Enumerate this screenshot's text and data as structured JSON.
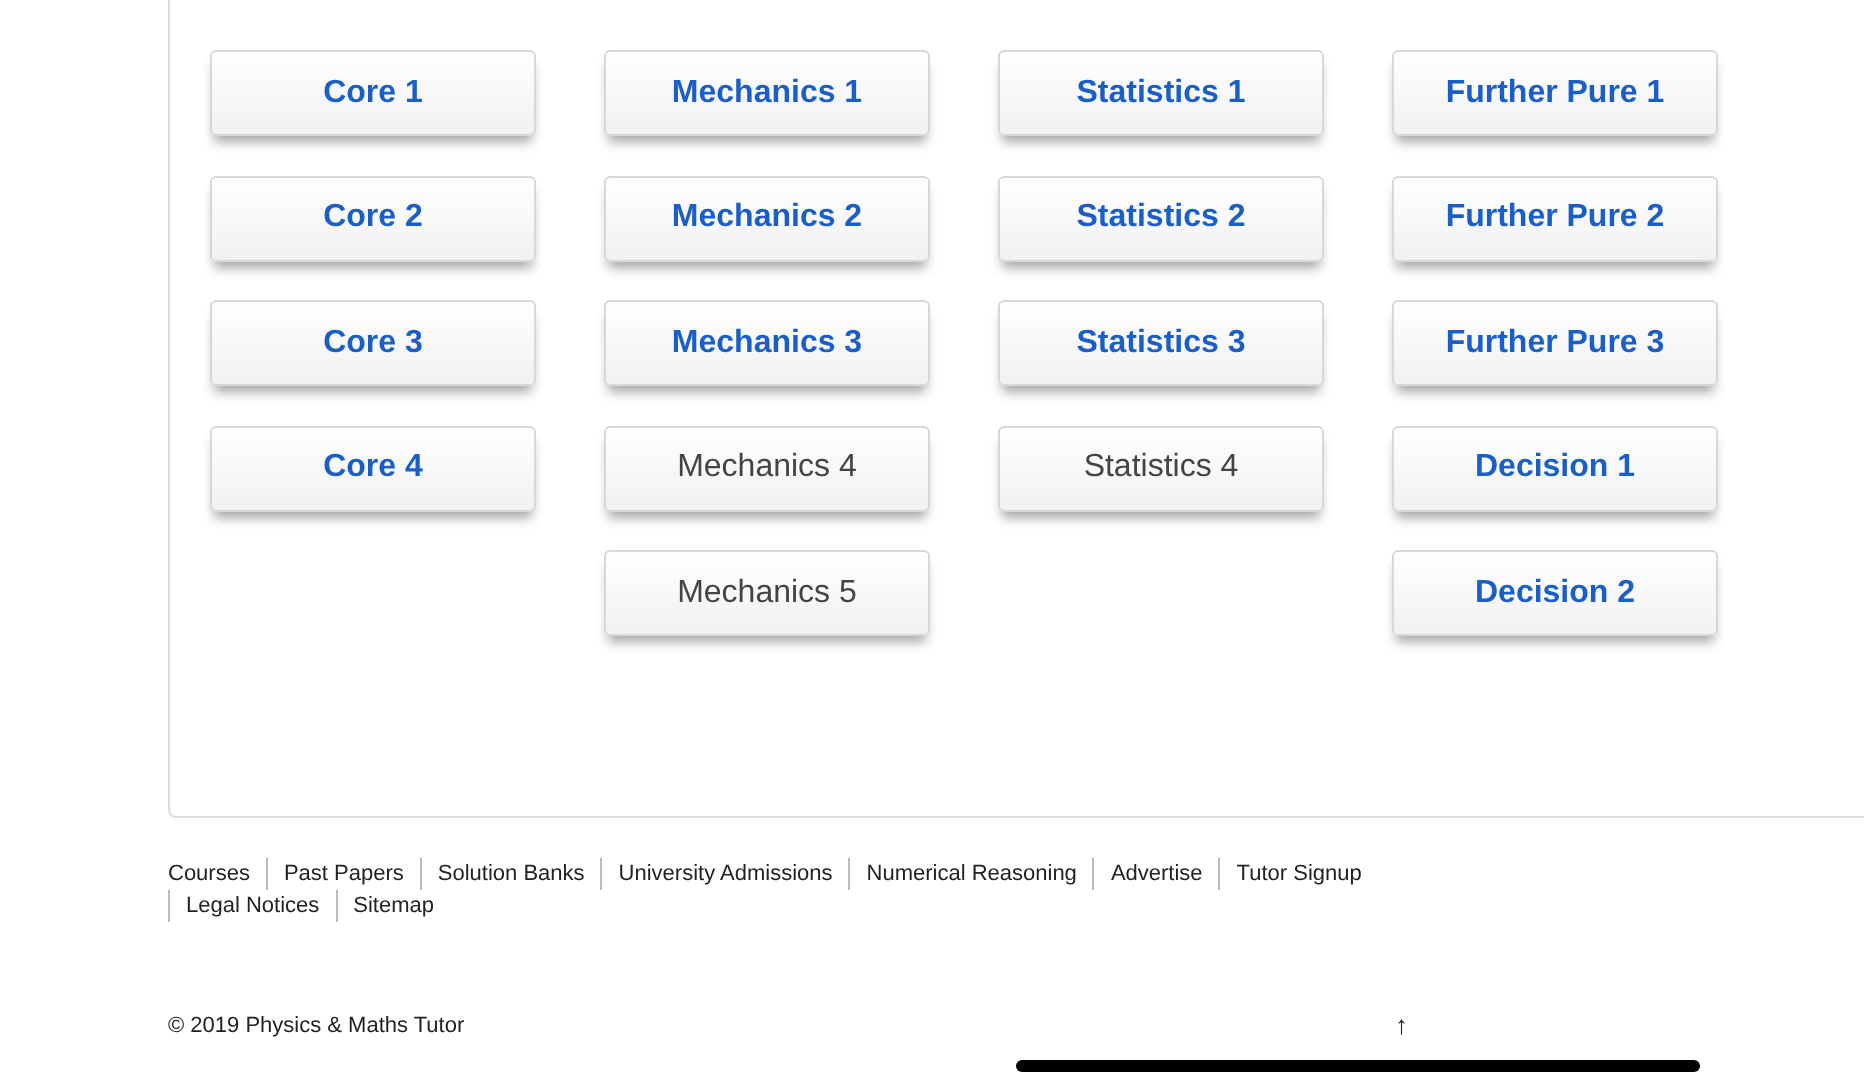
{
  "columns": [
    {
      "buttons": [
        {
          "label": "Core 1",
          "disabled": false
        },
        {
          "label": "Core 2",
          "disabled": false
        },
        {
          "label": "Core 3",
          "disabled": false
        },
        {
          "label": "Core 4",
          "disabled": false
        }
      ]
    },
    {
      "buttons": [
        {
          "label": "Mechanics 1",
          "disabled": false
        },
        {
          "label": "Mechanics 2",
          "disabled": false
        },
        {
          "label": "Mechanics 3",
          "disabled": false
        },
        {
          "label": "Mechanics 4",
          "disabled": true
        },
        {
          "label": "Mechanics 5",
          "disabled": true
        }
      ]
    },
    {
      "buttons": [
        {
          "label": "Statistics 1",
          "disabled": false
        },
        {
          "label": "Statistics 2",
          "disabled": false
        },
        {
          "label": "Statistics 3",
          "disabled": false
        },
        {
          "label": "Statistics 4",
          "disabled": true
        }
      ]
    },
    {
      "buttons": [
        {
          "label": "Further Pure 1",
          "disabled": false
        },
        {
          "label": "Further Pure 2",
          "disabled": false
        },
        {
          "label": "Further Pure 3",
          "disabled": false
        },
        {
          "label": "Decision 1",
          "disabled": false
        },
        {
          "label": "Decision 2",
          "disabled": false
        }
      ]
    }
  ],
  "footer": {
    "links": [
      "Courses",
      "Past Papers",
      "Solution Banks",
      "University Admissions",
      "Numerical Reasoning",
      "Advertise",
      "Tutor Signup",
      "Legal Notices",
      "Sitemap"
    ],
    "copyright": "© 2019 Physics & Maths Tutor",
    "back_to_top": "↑"
  }
}
